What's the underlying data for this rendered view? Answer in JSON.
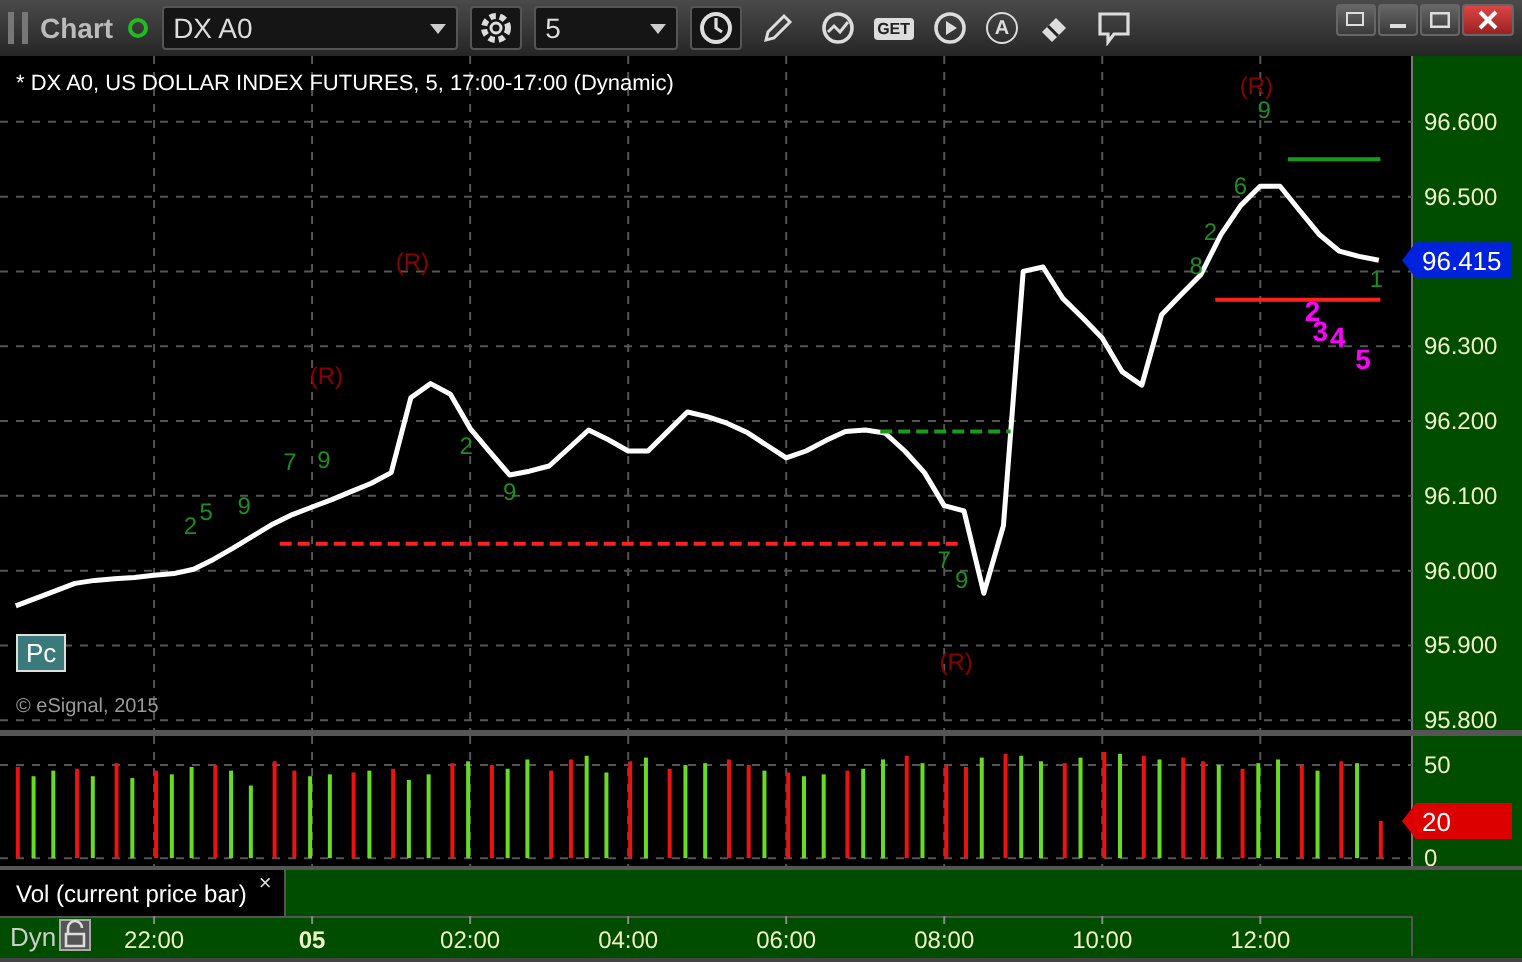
{
  "window": {
    "title": "Chart",
    "symbol": "DX A0",
    "interval": "5",
    "toolbar_texts": {
      "get": "GET",
      "auto": "A"
    }
  },
  "price_pane": {
    "header": "* DX A0, US DOLLAR INDEX FUTURES, 5, 17:00-17:00 (Dynamic)",
    "button": "Pc",
    "copyright": "© eSignal, 2015",
    "last_price": "96.415",
    "markers": [
      {
        "text": "(R)",
        "color": "#8b0000"
      },
      {
        "text": "(R)",
        "color": "#8b0000"
      },
      {
        "text": "(R)",
        "color": "#8b0000"
      },
      {
        "text": "(R)",
        "color": "#8b0000"
      },
      {
        "text": "9",
        "color": "#1e8c1e"
      },
      {
        "text": "2",
        "color": "#1e8c1e"
      },
      {
        "text": "5",
        "color": "#1e8c1e"
      },
      {
        "text": "9",
        "color": "#1e8c1e"
      },
      {
        "text": "7",
        "color": "#1e8c1e"
      },
      {
        "text": "9",
        "color": "#1e8c1e"
      },
      {
        "text": "2",
        "color": "#1e8c1e"
      },
      {
        "text": "9",
        "color": "#1e8c1e"
      },
      {
        "text": "7",
        "color": "#1e8c1e"
      },
      {
        "text": "9",
        "color": "#1e8c1e"
      },
      {
        "text": "8",
        "color": "#1e8c1e"
      },
      {
        "text": "2",
        "color": "#1e8c1e"
      },
      {
        "text": "6",
        "color": "#1e8c1e"
      },
      {
        "text": "1",
        "color": "#1e8c1e"
      },
      {
        "text": "2",
        "color": "#ff00ff"
      },
      {
        "text": "3",
        "color": "#ff00ff"
      },
      {
        "text": "4",
        "color": "#ff00ff"
      },
      {
        "text": "5",
        "color": "#ff00ff"
      }
    ],
    "chart_data": {
      "type": "line",
      "grid": true,
      "ylim": [
        95.787,
        96.688
      ],
      "yticks": [
        {
          "value": 95.8,
          "label": "95.800"
        },
        {
          "value": 95.9,
          "label": "95.900"
        },
        {
          "value": 96.0,
          "label": "96.000"
        },
        {
          "value": 96.1,
          "label": "96.100"
        },
        {
          "value": 96.2,
          "label": "96.200"
        },
        {
          "value": 96.3,
          "label": "96.300"
        },
        {
          "value": 96.5,
          "label": "96.500"
        },
        {
          "value": 96.6,
          "label": "96.600"
        }
      ],
      "categories": [
        null,
        null,
        null,
        null,
        null,
        null,
        null,
        null,
        null,
        null,
        null,
        null,
        null,
        null,
        null,
        null,
        null,
        null,
        null,
        null,
        null,
        null,
        null,
        null,
        null,
        null,
        null,
        null,
        null,
        null,
        null,
        null,
        null,
        null,
        null,
        null,
        null,
        null,
        null,
        null,
        null,
        null,
        null,
        null,
        null,
        null,
        null,
        null,
        null,
        null,
        null,
        null,
        null,
        null,
        null,
        null,
        null,
        null,
        null,
        null,
        null,
        null,
        null,
        null,
        null,
        null,
        null,
        null,
        null,
        null
      ],
      "series": [
        {
          "color": "#ffffff",
          "values": [
            95.953,
            95.963,
            95.973,
            95.983,
            95.987,
            95.989,
            95.991,
            95.994,
            95.996,
            96.002,
            96.015,
            96.03,
            96.046,
            96.062,
            96.075,
            96.085,
            96.095,
            96.106,
            96.117,
            96.131,
            96.231,
            96.25,
            96.236,
            96.19,
            96.159,
            96.128,
            96.133,
            96.14,
            96.164,
            96.188,
            96.175,
            96.16,
            96.16,
            96.186,
            96.212,
            96.206,
            96.197,
            96.185,
            96.168,
            96.151,
            96.16,
            96.174,
            96.186,
            96.188,
            96.184,
            96.16,
            96.131,
            96.087,
            96.08,
            95.97,
            96.06,
            96.4,
            96.406,
            96.364,
            96.338,
            96.311,
            96.266,
            96.248,
            96.342,
            96.369,
            96.396,
            96.449,
            96.488,
            96.514,
            96.514,
            96.481,
            96.449,
            96.427,
            96.42,
            96.415
          ]
        }
      ]
    }
  },
  "volume_pane": {
    "label": "Vol (current price bar)",
    "close": "×",
    "last_volume": "20",
    "chart_data": {
      "type": "bar",
      "grid": true,
      "ylim": [
        -4.2,
        65.6
      ],
      "yticks": [
        {
          "value": 0,
          "label": "0"
        },
        {
          "value": 50,
          "label": "50"
        }
      ],
      "categories": [
        null,
        null,
        null,
        null,
        null,
        null,
        null,
        "22:00",
        null,
        null,
        null,
        null,
        null,
        null,
        null,
        "05",
        null,
        null,
        null,
        null,
        null,
        null,
        null,
        "02:00",
        null,
        null,
        null,
        null,
        null,
        null,
        null,
        "04:00",
        null,
        null,
        null,
        null,
        null,
        null,
        null,
        "06:00",
        null,
        null,
        null,
        null,
        null,
        null,
        null,
        "08:00",
        null,
        null,
        null,
        null,
        null,
        null,
        null,
        "10:00",
        null,
        null,
        null,
        null,
        null,
        null,
        null,
        "12:00",
        null,
        null,
        null,
        null,
        null,
        null
      ],
      "series": [
        {
          "color": "#66dd22",
          "values": [
            null,
            44,
            47,
            null,
            44,
            null,
            43,
            null,
            45,
            49,
            null,
            47,
            39,
            null,
            null,
            44,
            45,
            null,
            47,
            null,
            42,
            45,
            null,
            52,
            null,
            48,
            53,
            null,
            null,
            55,
            46,
            null,
            54,
            null,
            50,
            51,
            null,
            null,
            47,
            null,
            44,
            45,
            null,
            48,
            53,
            null,
            51,
            null,
            null,
            54,
            null,
            55,
            52,
            null,
            54,
            null,
            56,
            null,
            53,
            null,
            null,
            50,
            null,
            51,
            53,
            null,
            47,
            null,
            51,
            null
          ]
        },
        {
          "color": "#ee1111",
          "values": [
            49,
            null,
            null,
            48,
            null,
            51,
            null,
            47,
            null,
            null,
            50,
            null,
            null,
            52,
            47,
            null,
            null,
            46,
            null,
            48,
            null,
            null,
            51,
            null,
            50,
            null,
            null,
            47,
            53,
            null,
            null,
            52,
            null,
            48,
            null,
            null,
            53,
            50,
            null,
            46,
            null,
            null,
            47,
            null,
            null,
            55,
            null,
            50,
            49,
            null,
            56,
            null,
            null,
            51,
            null,
            57,
            null,
            55,
            null,
            54,
            52,
            null,
            48,
            null,
            null,
            50,
            null,
            52,
            null,
            20
          ]
        }
      ]
    }
  },
  "time_axis": {
    "mode": "Dyn"
  }
}
